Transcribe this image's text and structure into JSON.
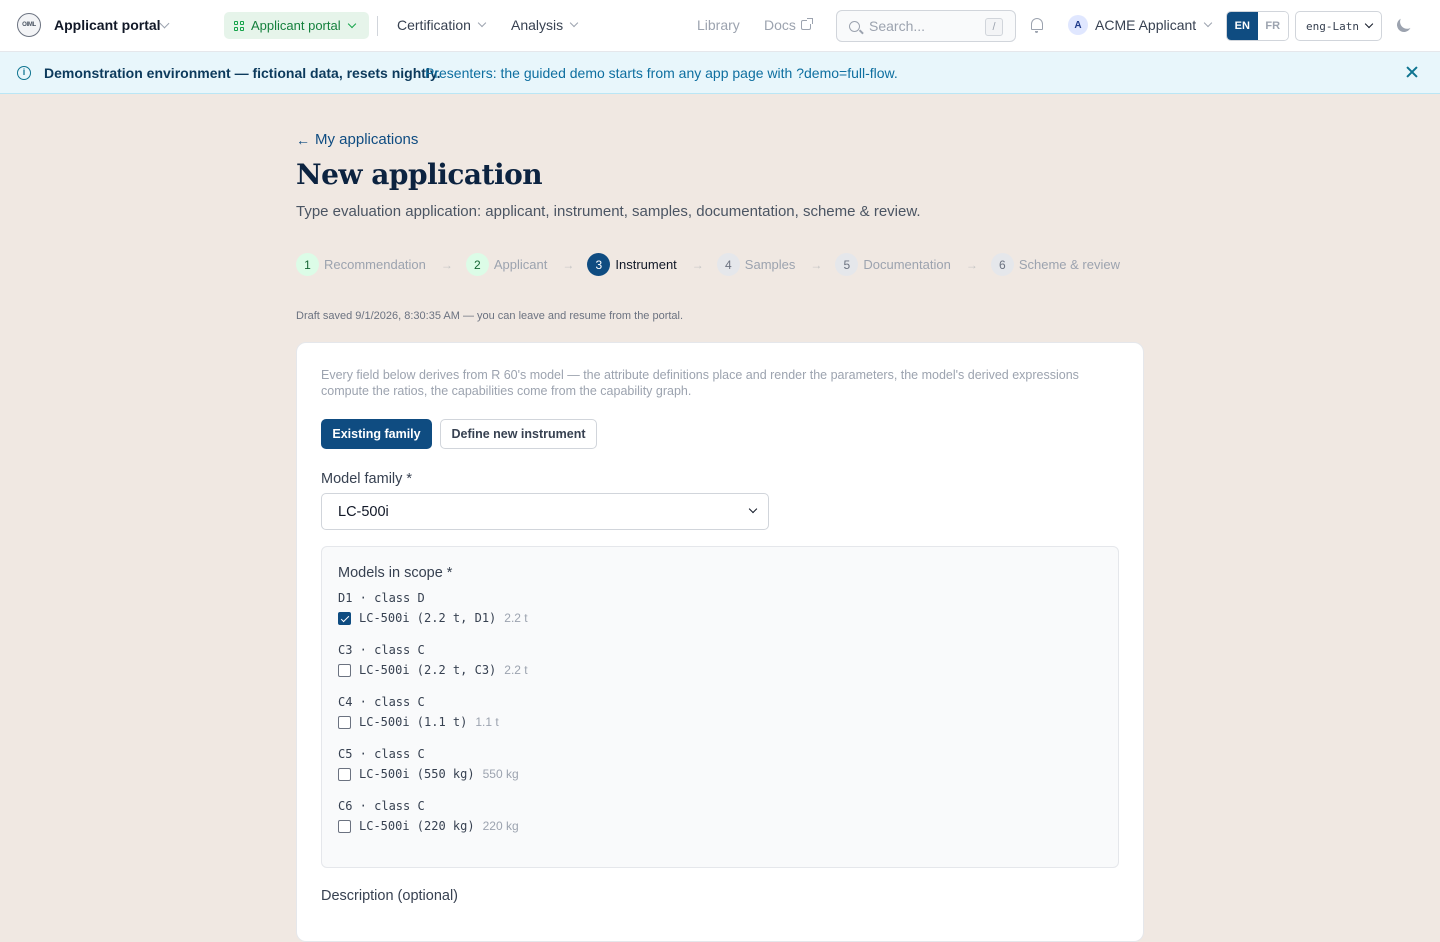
{
  "header": {
    "logo_text": "OIML",
    "app_title": "Applicant portal",
    "portal_pill": "Applicant portal",
    "nav": [
      "Certification",
      "Analysis"
    ],
    "links": [
      "Library",
      "Docs"
    ],
    "search_placeholder": "Search...",
    "search_shortcut": "/",
    "user_initial": "A",
    "user_name": "ACME Applicant",
    "lang_active": "EN",
    "lang_other": "FR",
    "script": "eng-Latn"
  },
  "banner": {
    "strong": "Demonstration environment — fictional data, resets nightly.",
    "text": "Presenters: the guided demo starts from any app page with ?demo=full-flow."
  },
  "page": {
    "back_link": "My applications",
    "title": "New application",
    "subtitle": "Type evaluation application: applicant, instrument, samples, documentation, scheme & review.",
    "draft_note": "Draft saved 9/1/2026, 8:30:35 AM — you can leave and resume from the portal."
  },
  "steps": [
    {
      "num": "1",
      "label": "Recommendation",
      "state": "done"
    },
    {
      "num": "2",
      "label": "Applicant",
      "state": "done"
    },
    {
      "num": "3",
      "label": "Instrument",
      "state": "current"
    },
    {
      "num": "4",
      "label": "Samples",
      "state": "todo"
    },
    {
      "num": "5",
      "label": "Documentation",
      "state": "todo"
    },
    {
      "num": "6",
      "label": "Scheme & review",
      "state": "todo"
    }
  ],
  "form": {
    "intro": "Every field below derives from R 60's model — the attribute definitions place and render the parameters, the model's derived expressions compute the ratios, the capabilities come from the capability graph.",
    "mode_active": "Existing family",
    "mode_other": "Define new instrument",
    "family_label": "Model family *",
    "family_value": "LC-500i",
    "scope_title": "Models in scope *",
    "groups": [
      {
        "label": "D1 · class D",
        "model": "LC-500i (2.2 t, D1)",
        "cap": "2.2 t",
        "checked": true
      },
      {
        "label": "C3 · class C",
        "model": "LC-500i (2.2 t, C3)",
        "cap": "2.2 t",
        "checked": false
      },
      {
        "label": "C4 · class C",
        "model": "LC-500i (1.1 t)",
        "cap": "1.1 t",
        "checked": false
      },
      {
        "label": "C5 · class C",
        "model": "LC-500i (550 kg)",
        "cap": "550 kg",
        "checked": false
      },
      {
        "label": "C6 · class C",
        "model": "LC-500i (220 kg)",
        "cap": "220 kg",
        "checked": false
      }
    ],
    "description_label": "Description (optional)"
  },
  "colors": {
    "accent": "#0f4c81",
    "page_bg": "#f0e8e2",
    "banner_bg": "#e8f6fb",
    "success": "#16a34a"
  }
}
